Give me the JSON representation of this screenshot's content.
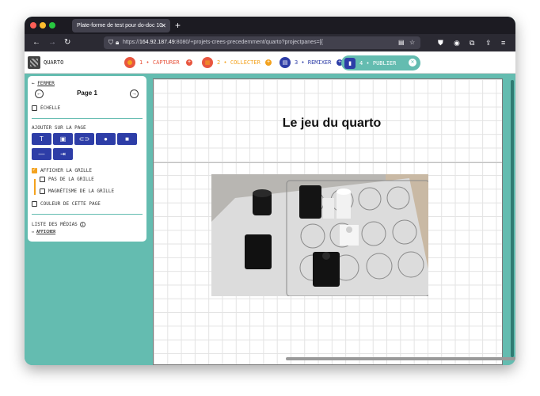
{
  "browser": {
    "tab_title": "Plate-forme de test pour do-doc 10",
    "tab_close": "✕",
    "new_tab": "+",
    "url_host": "164.92.187.49",
    "url_rest": ":8080/+projets-crees-precedemment/quarto?projectpanes=[{",
    "url_prefix": "https://"
  },
  "app": {
    "project_name": "QUARTO",
    "steps": [
      {
        "label": "1 • CAPTURER",
        "color": "#e8563f",
        "add": "+"
      },
      {
        "label": "2 • COLLECTER",
        "color": "#f3a21e",
        "add": "+"
      },
      {
        "label": "3 • REMIXER",
        "color": "#2d3da7",
        "add": "+"
      },
      {
        "label": "4 • PUBLIER",
        "color": "#2d3da7",
        "close": "✕"
      }
    ]
  },
  "panel": {
    "close_label": "FERMER",
    "close_arrow": "←",
    "page_title": "Page 1",
    "prev": "←",
    "next": "→",
    "scale_label": "ÉCHELLE",
    "add_section": "AJOUTER SUR LA PAGE",
    "tools": [
      "T",
      "▣",
      "⊂⊃",
      "●",
      "■",
      "—",
      "⇥"
    ],
    "show_grid": "AFFICHER LA GRILLE",
    "grid_step": "PAS DE LA GRILLE",
    "grid_magnet": "MAGNÉTISME DE LA GRILLE",
    "page_color": "COULEUR DE CETTE PAGE",
    "media_list": "LISTE DES MÉDIAS",
    "info": "i",
    "show": "AFFICHER"
  },
  "document": {
    "title": "Le jeu du quarto"
  }
}
